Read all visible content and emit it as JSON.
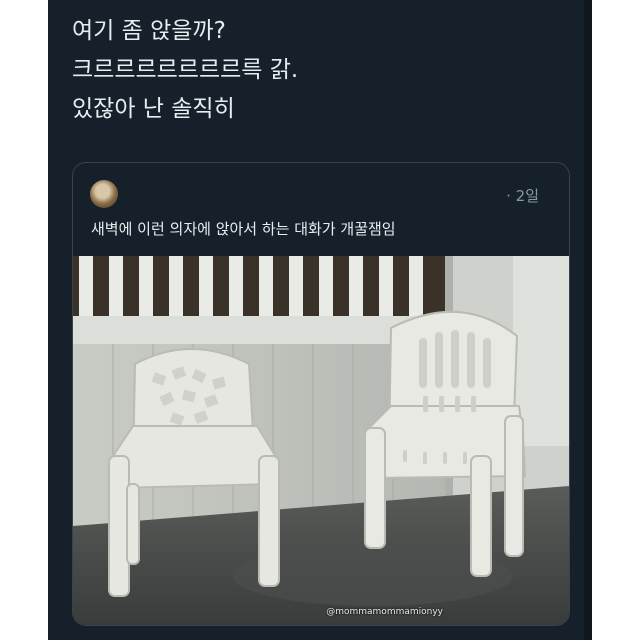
{
  "tweet": {
    "lines": [
      "여기 좀 앉을까?",
      "크르르르르르르르륵 갉.",
      "있잖아 난 솔직히"
    ]
  },
  "quote": {
    "avatar_icon": "user-avatar-icon",
    "time": "· 2일",
    "text": "새벽에 이런 의자에 앉아서 하는 대화가 개꿀잼임",
    "watermark": "@mommamommamionyy"
  },
  "colors": {
    "background": "#15202b",
    "text": "#e7ecef",
    "muted": "#8899a6",
    "border": "#38444d"
  }
}
